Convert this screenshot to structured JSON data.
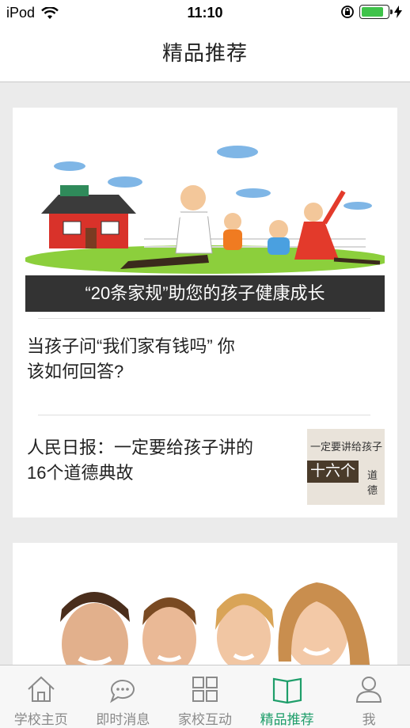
{
  "status_bar": {
    "device": "iPod",
    "time": "11:10",
    "battery_level": 0.85
  },
  "nav": {
    "title": "精品推荐"
  },
  "cards": [
    {
      "hero_caption": "“20条家规”助您的孩子健康成长",
      "articles": [
        {
          "title": "当孩子问“我们家有钱吗” 你\n该如何回答?"
        },
        {
          "title": "人民日报：一定要给孩子讲的\n16个道德典故",
          "thumb": {
            "line1": "一定要讲给孩子",
            "line2": "十六个",
            "line3": "道德"
          }
        }
      ]
    }
  ],
  "tabs": [
    {
      "label": "学校主页",
      "icon": "home-icon"
    },
    {
      "label": "即时消息",
      "icon": "chat-icon"
    },
    {
      "label": "家校互动",
      "icon": "grid-icon"
    },
    {
      "label": "精品推荐",
      "icon": "book-icon",
      "active": true
    },
    {
      "label": "我",
      "icon": "person-icon"
    }
  ],
  "colors": {
    "accent": "#1e9e6a",
    "tab_inactive": "#8a8a8a",
    "caption_bg": "#333333"
  }
}
